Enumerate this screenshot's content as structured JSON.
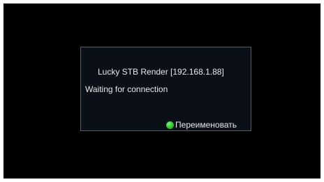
{
  "dialog": {
    "title": "Lucky STB Render  [192.168.1.88]",
    "status": "Waiting for connection",
    "rename_label": "Переименовать",
    "rename_key_color": "green",
    "rename_key_icon": "green-button-icon"
  },
  "colors": {
    "background": "#000000",
    "dialog_background": "#0b1018",
    "dialog_border": "#5a4fae",
    "text": "#e8e8ea",
    "green_key": "#31c02e"
  }
}
